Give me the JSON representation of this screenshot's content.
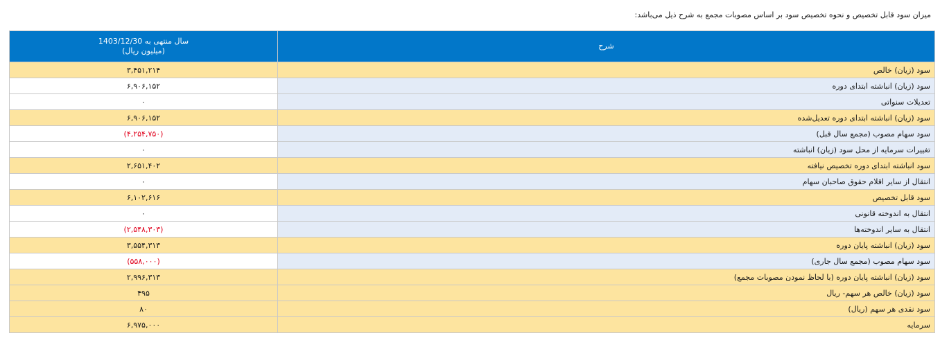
{
  "page": {
    "title": "میزان سود قابل تخصیص و نحوه تخصیص سود بر اساس مصوبات مجمع به شرح ذیل می‌باشد:"
  },
  "table": {
    "header": {
      "value_line1": "سال منتهی به 1403/12/30",
      "value_line2": "(میلیون ریال)",
      "description": "شرح"
    },
    "rows": [
      {
        "label": "سود (زیان) خالص",
        "value": "۳,۴۵۱,۲۱۴",
        "highlight": true,
        "negative": false
      },
      {
        "label": "سود (زیان) انباشته ابتدای دوره",
        "value": "۶,۹۰۶,۱۵۲",
        "highlight": false,
        "negative": false
      },
      {
        "label": "تعدیلات سنواتی",
        "value": "۰",
        "highlight": false,
        "negative": false
      },
      {
        "label": "سود (زیان) انباشته ابتدای دوره تعدیل‌شده",
        "value": "۶,۹۰۶,۱۵۲",
        "highlight": true,
        "negative": false
      },
      {
        "label": "سود سهام مصوب (مجمع سال قبل)",
        "value": "(۴,۲۵۴,۷۵۰)",
        "highlight": false,
        "negative": true
      },
      {
        "label": "تغییرات سرمایه از محل سود (زیان) انباشته",
        "value": "۰",
        "highlight": false,
        "negative": false
      },
      {
        "label": "سود انباشته ابتدای دوره تخصیص نیافته",
        "value": "۲,۶۵۱,۴۰۲",
        "highlight": true,
        "negative": false
      },
      {
        "label": "انتقال از سایر اقلام حقوق صاحبان سهام",
        "value": "۰",
        "highlight": false,
        "negative": false
      },
      {
        "label": "سود قابل تخصیص",
        "value": "۶,۱۰۲,۶۱۶",
        "highlight": true,
        "negative": false
      },
      {
        "label": "انتقال به اندوخته قانونی",
        "value": "۰",
        "highlight": false,
        "negative": false
      },
      {
        "label": "انتقال به سایر اندوخته‌ها",
        "value": "(۲,۵۴۸,۳۰۳)",
        "highlight": false,
        "negative": true
      },
      {
        "label": "سود (زیان) انباشته پایان دوره",
        "value": "۳,۵۵۴,۳۱۳",
        "highlight": true,
        "negative": false
      },
      {
        "label": "سود سهام مصوب (مجمع سال جاری)",
        "value": "(۵۵۸,۰۰۰)",
        "highlight": false,
        "negative": true
      },
      {
        "label": "سود (زیان) انباشته پایان دوره (با لحاظ نمودن مصوبات مجمع)",
        "value": "۲,۹۹۶,۳۱۳",
        "highlight": true,
        "negative": false
      },
      {
        "label": "سود (زیان) خالص هر سهم- ریال",
        "value": "۴۹۵",
        "highlight": true,
        "negative": false
      },
      {
        "label": "سود نقدی هر سهم (ریال)",
        "value": "۸۰",
        "highlight": true,
        "negative": false
      },
      {
        "label": "سرمایه",
        "value": "۶,۹۷۵,۰۰۰",
        "highlight": true,
        "negative": false
      }
    ]
  }
}
